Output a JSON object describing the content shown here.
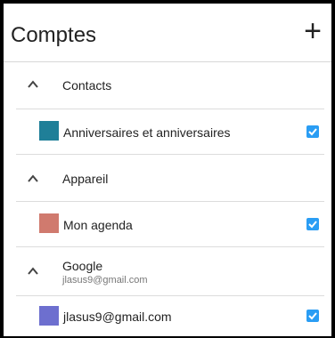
{
  "header": {
    "title": "Comptes",
    "add_icon": "plus-icon"
  },
  "groups": [
    {
      "title": "Contacts",
      "items": [
        {
          "label": "Anniversaires et anniversaires",
          "color": "#1f7f98",
          "checked": true
        }
      ]
    },
    {
      "title": "Appareil",
      "items": [
        {
          "label": "Mon agenda",
          "color": "#d07a6e",
          "checked": true
        }
      ]
    },
    {
      "title": "Google",
      "subtitle": "jlasus9@gmail.com",
      "items": [
        {
          "label": "jlasus9@gmail.com",
          "color": "#6d6fcf",
          "checked": true
        }
      ]
    }
  ],
  "colors": {
    "accent": "#2a9df4",
    "separator": "#dcdcdc"
  }
}
